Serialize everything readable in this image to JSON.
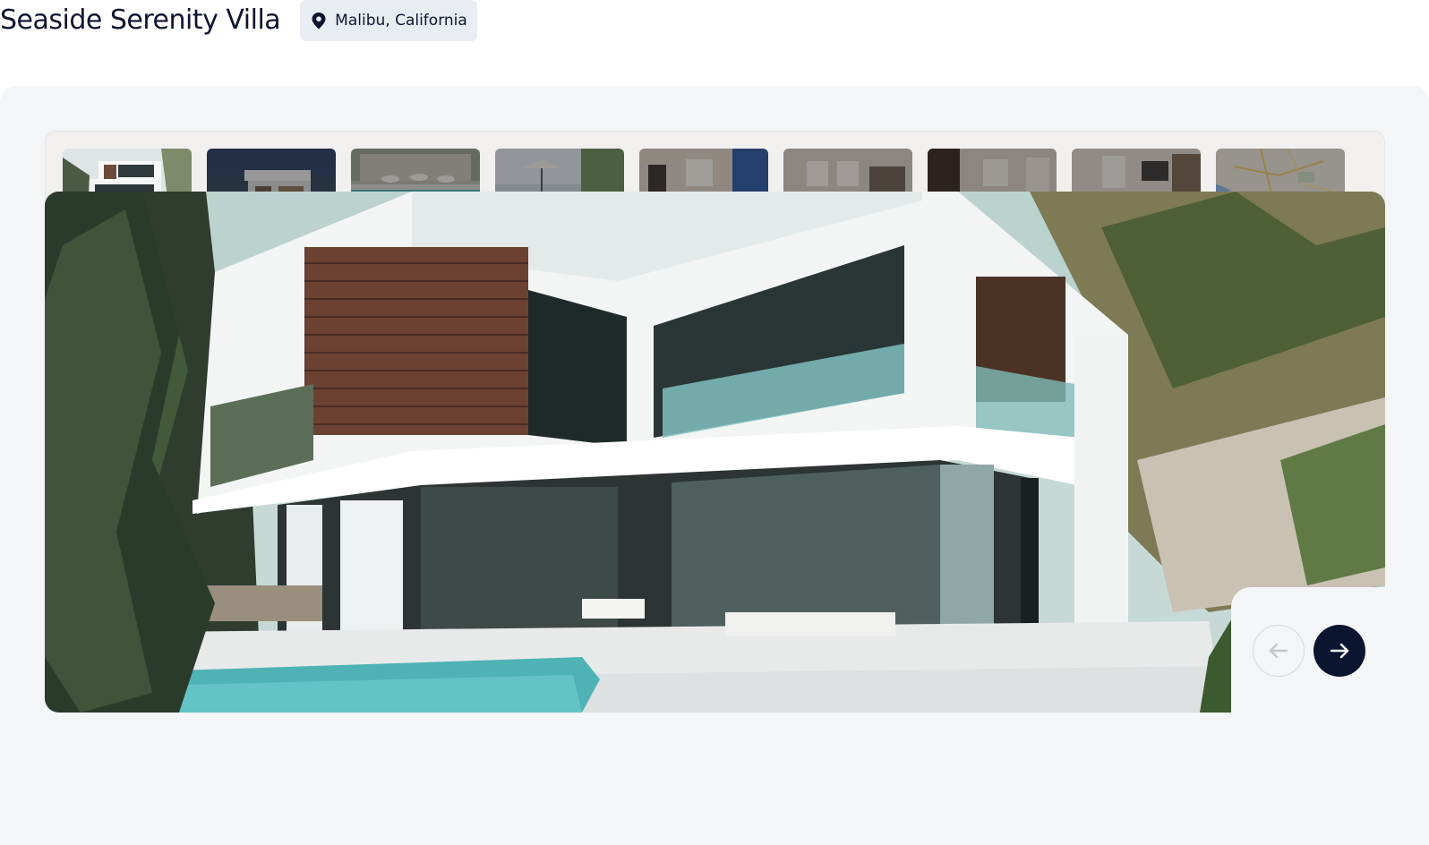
{
  "listing": {
    "title": "Seaside Serenity Villa",
    "location": "Malibu, California",
    "location_icon": "map-pin-icon"
  },
  "gallery": {
    "thumbnails": [
      {
        "subject": "villa exterior with pool",
        "active": true
      },
      {
        "subject": "villa exterior at dusk with pool",
        "active": false
      },
      {
        "subject": "resort pool with umbrellas",
        "active": false
      },
      {
        "subject": "poolside loungers",
        "active": false
      },
      {
        "subject": "living room interior",
        "active": false
      },
      {
        "subject": "open-plan living area",
        "active": false
      },
      {
        "subject": "dining area",
        "active": false
      },
      {
        "subject": "lounge interior",
        "active": false
      },
      {
        "subject": "map of area",
        "active": false
      }
    ],
    "prev_icon": "arrow-left-icon",
    "next_icon": "arrow-right-icon",
    "prev_enabled": false,
    "next_enabled": true
  },
  "colors": {
    "title": "#0e1530",
    "location_bg": "#e9edf2",
    "panel_bg": "#f4f5f6",
    "next_button": "#0b1530",
    "pool": "#5fc3c8"
  }
}
